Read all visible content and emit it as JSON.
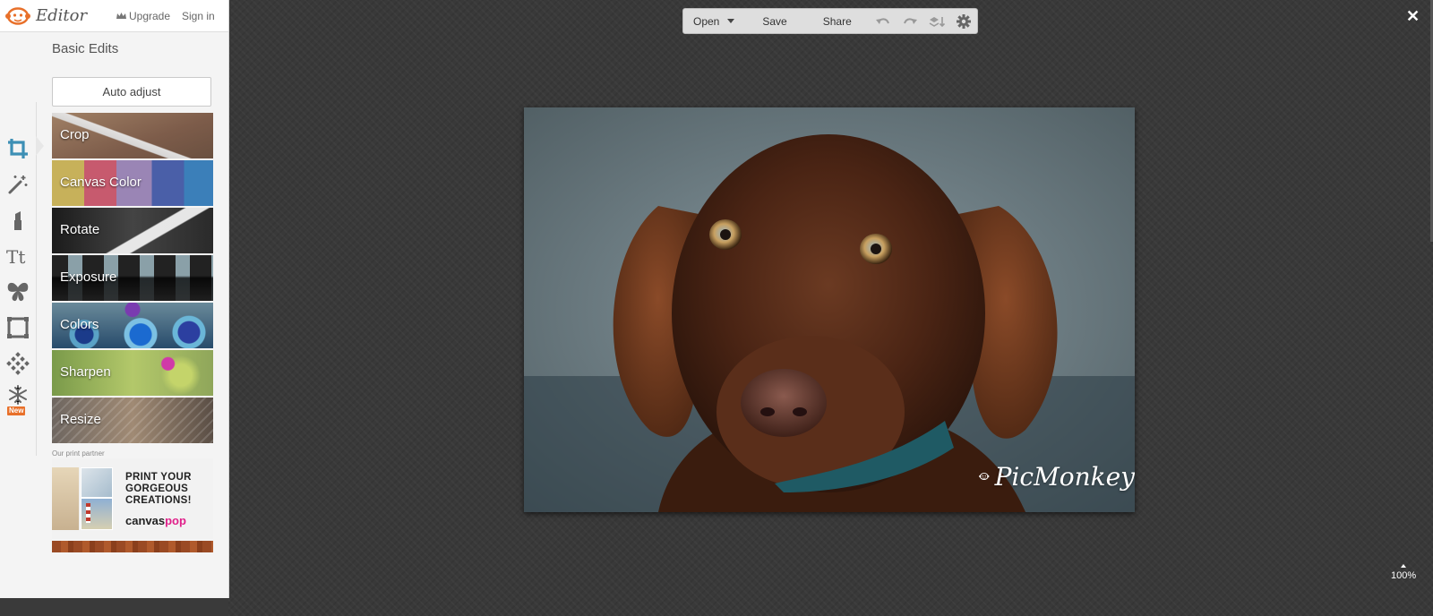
{
  "header": {
    "brand": "Editor",
    "upgrade": "Upgrade",
    "sign_in": "Sign in"
  },
  "panel": {
    "title": "Basic Edits",
    "auto_adjust": "Auto adjust",
    "items": [
      {
        "label": "Crop"
      },
      {
        "label": "Canvas Color"
      },
      {
        "label": "Rotate"
      },
      {
        "label": "Exposure"
      },
      {
        "label": "Colors"
      },
      {
        "label": "Sharpen"
      },
      {
        "label": "Resize"
      }
    ],
    "partner_label": "Our print partner",
    "ad_text": "PRINT YOUR\nGORGEOUS\nCREATIONS!",
    "ad_brand_a": "canvas",
    "ad_brand_b": "pop"
  },
  "tools": {
    "new_badge": "New",
    "icons": [
      "crop-icon",
      "magic-wand-icon",
      "lipstick-icon",
      "text-icon",
      "butterfly-icon",
      "frame-icon",
      "texture-icon",
      "snowflake-icon"
    ],
    "accent": "#3d8fb5"
  },
  "toolbar": {
    "open": "Open",
    "save": "Save",
    "share": "Share"
  },
  "canvas": {
    "watermark": "PicMonkey",
    "zoom": "100%",
    "close": "✕"
  }
}
